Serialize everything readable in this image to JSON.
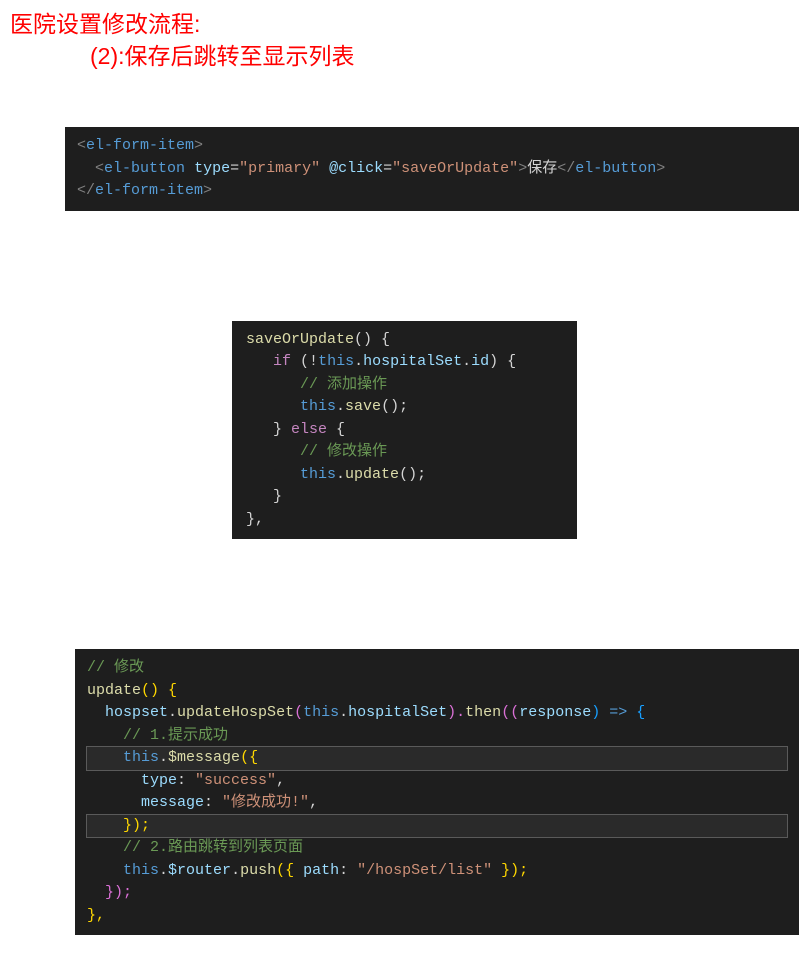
{
  "heading": {
    "line1": "医院设置修改流程:",
    "line2": "(2):保存后跳转至显示列表"
  },
  "code1": {
    "t1a": "<",
    "t1b": "el-form-item",
    "t1c": ">",
    "t2a": "<",
    "t2b": "el-button",
    "t2c": "type",
    "t2d": "=",
    "t2e": "\"primary\"",
    "t2f": "@click",
    "t2g": "=",
    "t2h": "\"saveOrUpdate\"",
    "t2i": ">",
    "t2j": "保存",
    "t2k": "</",
    "t2l": "el-button",
    "t2m": ">",
    "t3a": "</",
    "t3b": "el-form-item",
    "t3c": ">"
  },
  "code2": {
    "l1a": "saveOrUpdate",
    "l1b": "() {",
    "l2a": "if",
    "l2b": " (",
    "l2c": "!",
    "l2d": "this",
    "l2e": ".",
    "l2f": "hospitalSet",
    "l2g": ".",
    "l2h": "id",
    "l2i": ") {",
    "l3": "// 添加操作",
    "l4a": "this",
    "l4b": ".",
    "l4c": "save",
    "l4d": "();",
    "l5a": "} ",
    "l5b": "else",
    "l5c": " {",
    "l6": "// 修改操作",
    "l7a": "this",
    "l7b": ".",
    "l7c": "update",
    "l7d": "();",
    "l8": "}",
    "l9": "},"
  },
  "code3": {
    "l1": "// 修改",
    "l2a": "update",
    "l2b": "() {",
    "l3a": "hospset",
    "l3b": ".",
    "l3c": "updateHospSet",
    "l3d": "(",
    "l3e": "this",
    "l3f": ".",
    "l3g": "hospitalSet",
    "l3h": ").",
    "l3i": "then",
    "l3j": "((",
    "l3k": "response",
    "l3l": ") ",
    "l3m": "=>",
    "l3n": " {",
    "l4": "// 1.提示成功",
    "l5a": "this",
    "l5b": ".",
    "l5c": "$message",
    "l5d": "({",
    "l6a": "type",
    "l6b": ": ",
    "l6c": "\"success\"",
    "l6d": ",",
    "l7a": "message",
    "l7b": ": ",
    "l7c": "\"修改成功!\"",
    "l7d": ",",
    "l8": "});",
    "l9": "// 2.路由跳转到列表页面",
    "l10a": "this",
    "l10b": ".",
    "l10c": "$router",
    "l10d": ".",
    "l10e": "push",
    "l10f": "({ ",
    "l10g": "path",
    "l10h": ": ",
    "l10i": "\"/hospSet/list\"",
    "l10j": " });",
    "l11": "});",
    "l12": "},"
  }
}
